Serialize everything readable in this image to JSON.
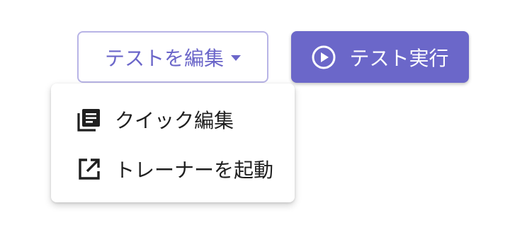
{
  "toolbar": {
    "edit_label": "テストを編集",
    "run_label": "テスト実行"
  },
  "menu": {
    "items": [
      {
        "label": "クイック編集",
        "icon": "quick-edit-icon"
      },
      {
        "label": "トレーナーを起動",
        "icon": "open-external-icon"
      }
    ]
  },
  "colors": {
    "accent": "#6b67c9",
    "outline": "#b8b4e6",
    "text": "#1f1f1f"
  }
}
